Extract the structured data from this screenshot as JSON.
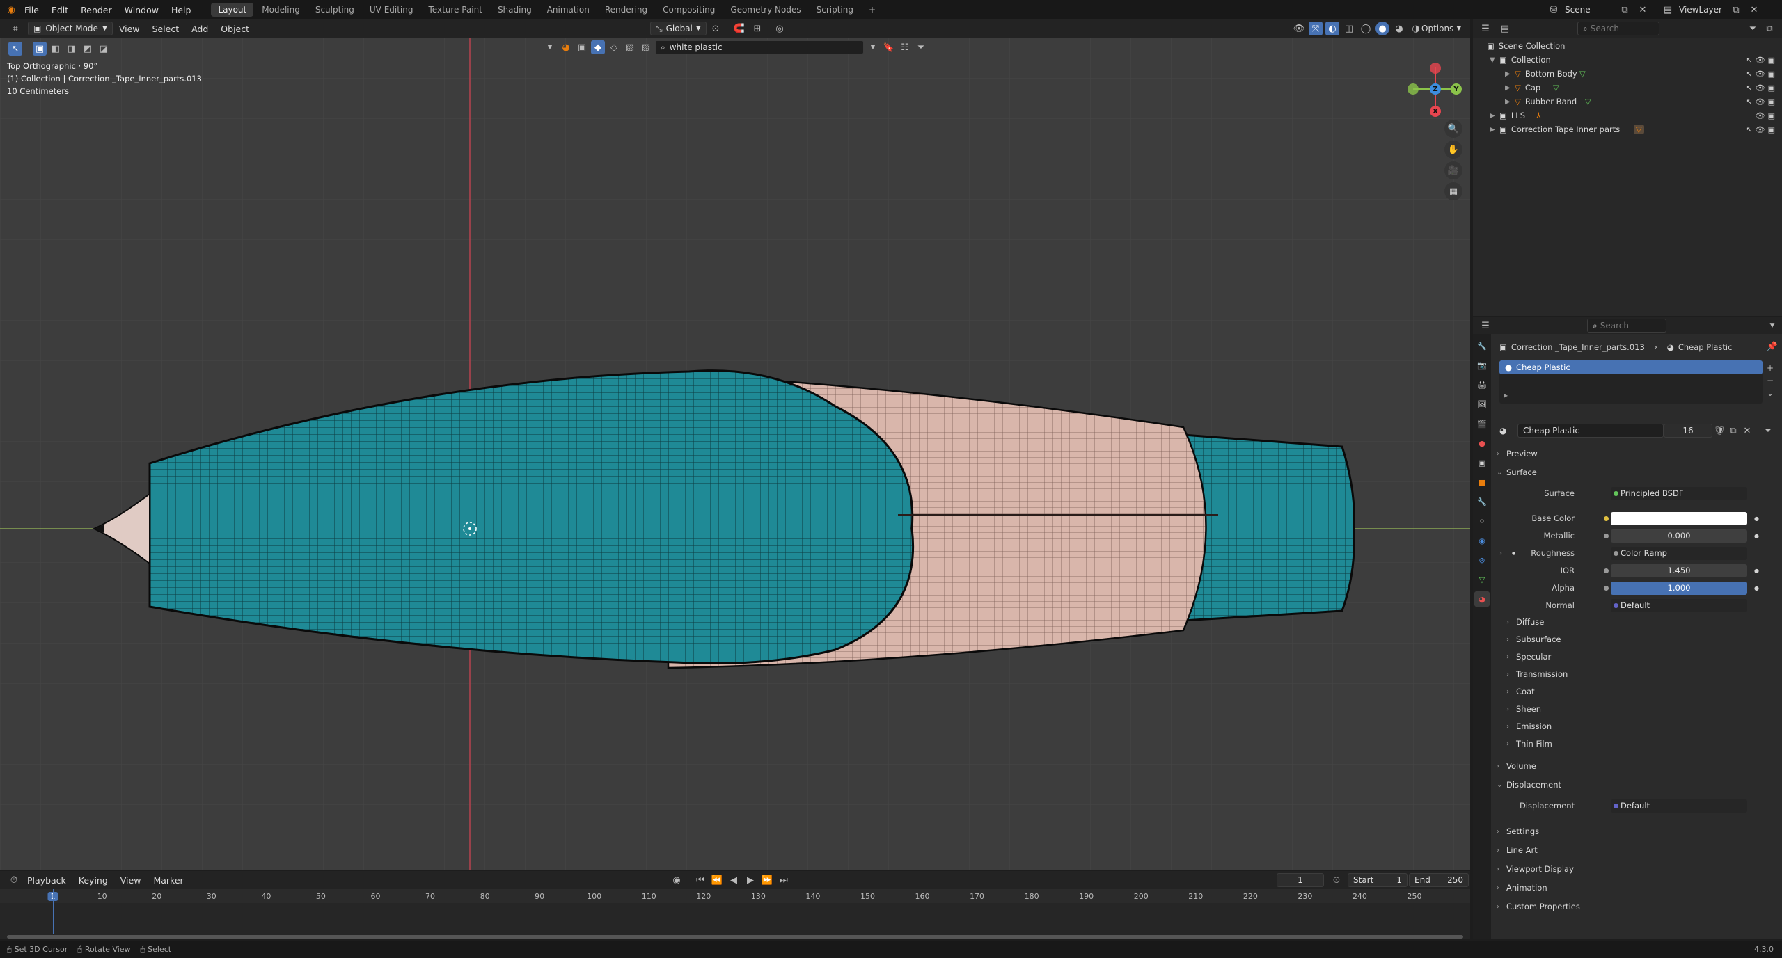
{
  "topbar": {
    "menus": [
      "File",
      "Edit",
      "Render",
      "Window",
      "Help"
    ],
    "workspaces": [
      "Layout",
      "Modeling",
      "Sculpting",
      "UV Editing",
      "Texture Paint",
      "Shading",
      "Animation",
      "Rendering",
      "Compositing",
      "Geometry Nodes",
      "Scripting"
    ],
    "active_workspace": "Layout",
    "add_tab": "+",
    "scene_label": "Scene",
    "viewlayer_label": "ViewLayer"
  },
  "viewport_header": {
    "mode": "Object Mode",
    "menus": [
      "View",
      "Select",
      "Add",
      "Object"
    ],
    "orientation": "Global",
    "search_value": "white plastic",
    "options_label": "Options"
  },
  "viewport": {
    "view_name": "Top Orthographic · 90°",
    "collection_info": "(1) Collection | Correction _Tape_Inner_parts.013",
    "scale": "10 Centimeters",
    "axis_colors": {
      "x": "#e8454f",
      "y": "#8bc34a",
      "z": "#3d8ee0"
    },
    "model_colors": {
      "teal": "#1f8a96",
      "pink": "#d9b6ab",
      "wire": "#111111"
    }
  },
  "outliner": {
    "search_placeholder": "Search",
    "root": "Scene Collection",
    "items": [
      {
        "label": "Collection",
        "depth": 0
      },
      {
        "label": "Bottom Body",
        "depth": 1
      },
      {
        "label": "Cap",
        "depth": 1
      },
      {
        "label": "Rubber Band",
        "depth": 1
      },
      {
        "label": "LLS",
        "depth": 0
      },
      {
        "label": "Correction Tape Inner parts",
        "depth": 0
      }
    ]
  },
  "properties": {
    "search_placeholder": "Search",
    "breadcrumb_object": "Correction _Tape_Inner_parts.013",
    "breadcrumb_material": "Cheap Plastic",
    "slot_name": "Cheap Plastic",
    "material_name": "Cheap Plastic",
    "user_count": "16",
    "panels": {
      "preview": "Preview",
      "surface": "Surface",
      "surface_label": "Surface",
      "surface_value": "Principled BSDF",
      "base_color_label": "Base Color",
      "metallic_label": "Metallic",
      "metallic_value": "0.000",
      "roughness_label": "Roughness",
      "roughness_value": "Color Ramp",
      "ior_label": "IOR",
      "ior_value": "1.450",
      "alpha_label": "Alpha",
      "alpha_value": "1.000",
      "normal_label": "Normal",
      "normal_value": "Default",
      "sub": [
        "Diffuse",
        "Subsurface",
        "Specular",
        "Transmission",
        "Coat",
        "Sheen",
        "Emission",
        "Thin Film"
      ],
      "volume": "Volume",
      "displacement": "Displacement",
      "displacement_label": "Displacement",
      "displacement_value": "Default",
      "bottom": [
        "Settings",
        "Line Art",
        "Viewport Display",
        "Animation",
        "Custom Properties"
      ]
    },
    "alpha_fill": 1.0
  },
  "timeline": {
    "menus": [
      "Playback",
      "Keying",
      "View",
      "Marker"
    ],
    "current_frame": "1",
    "start_label": "Start",
    "start_value": "1",
    "end_label": "End",
    "end_value": "250",
    "ticks": [
      "1",
      "10",
      "20",
      "30",
      "40",
      "50",
      "60",
      "70",
      "80",
      "90",
      "100",
      "110",
      "120",
      "130",
      "140",
      "150",
      "160",
      "170",
      "180",
      "190",
      "200",
      "210",
      "220",
      "230",
      "240",
      "250"
    ]
  },
  "statusbar": {
    "hints": [
      "Set 3D Cursor",
      "Rotate View",
      "Select"
    ],
    "version": "4.3.0"
  }
}
